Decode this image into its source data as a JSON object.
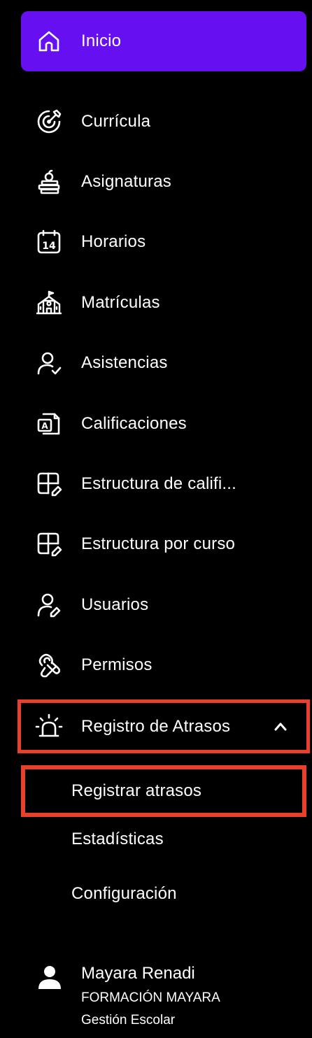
{
  "colors": {
    "background": "#000000",
    "active": "#6610f2",
    "highlight": "#e8402a",
    "text": "#ffffff"
  },
  "nav": {
    "items": [
      {
        "label": "Inicio",
        "icon": "home-icon"
      },
      {
        "label": "Currícula",
        "icon": "target-icon"
      },
      {
        "label": "Asignaturas",
        "icon": "books-apple-icon"
      },
      {
        "label": "Horarios",
        "icon": "calendar-icon"
      },
      {
        "label": "Matrículas",
        "icon": "school-building-icon"
      },
      {
        "label": "Asistencias",
        "icon": "user-check-icon"
      },
      {
        "label": "Calificaciones",
        "icon": "grades-document-icon"
      },
      {
        "label": "Estructura de califi...",
        "icon": "grid-edit-icon"
      },
      {
        "label": "Estructura por curso",
        "icon": "grid-edit-icon"
      },
      {
        "label": "Usuarios",
        "icon": "user-edit-icon"
      },
      {
        "label": "Permisos",
        "icon": "hand-permission-icon"
      },
      {
        "label": "Registro de Atrasos",
        "icon": "alarm-icon"
      }
    ],
    "subitems": [
      {
        "label": "Registrar atrasos"
      },
      {
        "label": "Estadísticas"
      },
      {
        "label": "Configuración"
      }
    ]
  },
  "user": {
    "name": "Mayara Renadi",
    "organization": "FORMACIÓN MAYARA",
    "app": "Gestión Escolar"
  }
}
